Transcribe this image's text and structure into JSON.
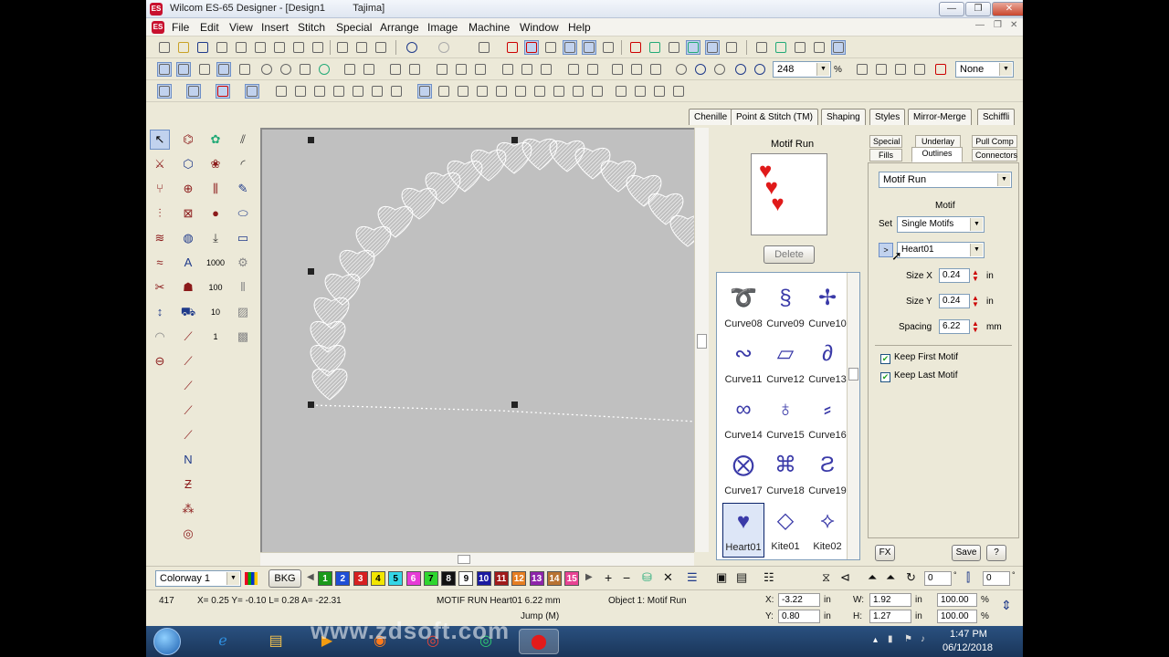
{
  "window": {
    "title": "Wilcom ES-65 Designer - [Design1          Tajima]",
    "min": "—",
    "max": "❐",
    "close": "✕"
  },
  "menu": [
    "File",
    "Edit",
    "View",
    "Insert",
    "Stitch",
    "Special",
    "Arrange",
    "Image",
    "Machine",
    "Window",
    "Help"
  ],
  "toolbar": {
    "zoom_value": "248",
    "zoom_unit": "%",
    "view_select": "None"
  },
  "side_tabs": [
    "Chenille",
    "Point & Stitch (TM)",
    "Shaping",
    "Styles",
    "Mirror-Merge",
    "Schiffli"
  ],
  "motif_panel": {
    "title": "Motif Run",
    "delete_label": "Delete",
    "items": [
      {
        "label": "Curve08",
        "glyph": "➰"
      },
      {
        "label": "Curve09",
        "glyph": "§"
      },
      {
        "label": "Curve10",
        "glyph": "✢"
      },
      {
        "label": "Curve11",
        "glyph": "∾"
      },
      {
        "label": "Curve12",
        "glyph": "▱"
      },
      {
        "label": "Curve13",
        "glyph": "∂"
      },
      {
        "label": "Curve14",
        "glyph": "∞"
      },
      {
        "label": "Curve15",
        "glyph": "♁"
      },
      {
        "label": "Curve16",
        "glyph": "⸗"
      },
      {
        "label": "Curve17",
        "glyph": "⨂"
      },
      {
        "label": "Curve18",
        "glyph": "⌘"
      },
      {
        "label": "Curve19",
        "glyph": "Ƨ"
      },
      {
        "label": "Heart01",
        "glyph": "♥"
      },
      {
        "label": "Kite01",
        "glyph": "◇"
      },
      {
        "label": "Kite02",
        "glyph": "⟡"
      }
    ]
  },
  "props": {
    "tabs_top": [
      "Special",
      "Underlay",
      "Pull Comp"
    ],
    "tabs_bottom": [
      "Fills",
      "Outlines",
      "Connectors"
    ],
    "stitch_type": "Motif Run",
    "motif_heading": "Motif",
    "set_label": "Set",
    "set_value": "Single Motifs",
    "motif_value": "Heart01",
    "size_x_label": "Size X",
    "size_x_value": "0.24",
    "size_x_unit": "in",
    "size_y_label": "Size Y",
    "size_y_value": "0.24",
    "size_y_unit": "in",
    "spacing_label": "Spacing",
    "spacing_value": "6.22",
    "spacing_unit": "mm",
    "keep_first": "Keep First Motif",
    "keep_last": "Keep Last Motif",
    "fx_label": "FX",
    "save_label": "Save",
    "help_label": "?"
  },
  "colorbar": {
    "colorway": "Colorway 1",
    "bkg": "BKG",
    "swatches": [
      {
        "n": "1",
        "c": "#1a9a1a"
      },
      {
        "n": "2",
        "c": "#1f4fd6"
      },
      {
        "n": "3",
        "c": "#d62020"
      },
      {
        "n": "4",
        "c": "#f2e600"
      },
      {
        "n": "5",
        "c": "#34d6e6"
      },
      {
        "n": "6",
        "c": "#e63bd6"
      },
      {
        "n": "7",
        "c": "#2fd62f"
      },
      {
        "n": "8",
        "c": "#111111"
      },
      {
        "n": "9",
        "c": "#ffffff"
      },
      {
        "n": "10",
        "c": "#1a1aa0"
      },
      {
        "n": "11",
        "c": "#a01a1a"
      },
      {
        "n": "12",
        "c": "#e67e22"
      },
      {
        "n": "13",
        "c": "#8e24aa"
      },
      {
        "n": "14",
        "c": "#b87333"
      },
      {
        "n": "15",
        "c": "#e84393"
      }
    ],
    "spin1": "0",
    "spin2": "0"
  },
  "status": {
    "stitches": "417",
    "coords": "X=  0.25 Y= -0.10 L=  0.28 A= -22.31",
    "object_info": "MOTIF RUN Heart01  6.22 mm",
    "object_num": "Object 1: Motif Run",
    "jump": "Jump (M)",
    "x_label": "X:",
    "x_value": "-3.22",
    "x_unit": "in",
    "y_label": "Y:",
    "y_value": "0.80",
    "y_unit": "in",
    "w_label": "W:",
    "w_value": "1.92",
    "w_unit": "in",
    "w_pct": "100.00",
    "h_label": "H:",
    "h_value": "1.27",
    "h_unit": "in",
    "h_pct": "100.00",
    "pct": "%"
  },
  "taskbar": {
    "time": "1:47 PM",
    "date": "06/12/2018"
  },
  "watermark": "www.zdsoft.com"
}
